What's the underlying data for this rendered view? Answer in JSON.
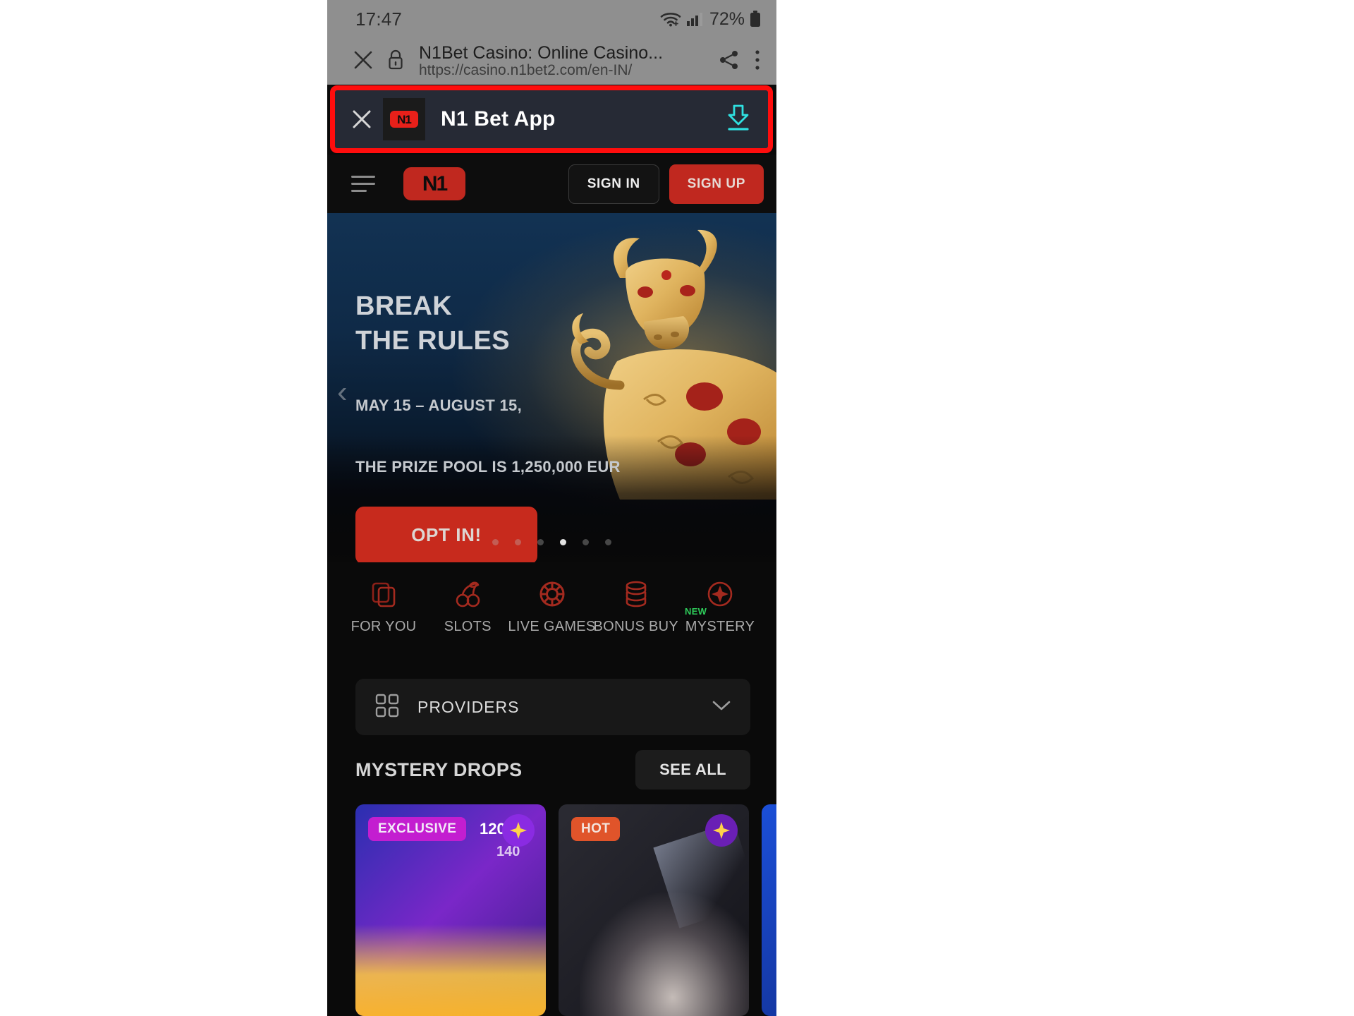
{
  "status_bar": {
    "time": "17:47",
    "battery_percent": "72%",
    "icons": [
      "wifi-icon",
      "cellular-signal-icon",
      "battery-icon"
    ]
  },
  "browser": {
    "close_icon": "close-icon",
    "lock_icon": "lock-icon",
    "page_title": "N1Bet Casino: Online Casino...",
    "page_url": "https://casino.n1bet2.com/en-IN/",
    "share_icon": "share-icon",
    "menu_icon": "overflow-menu-icon"
  },
  "app_banner": {
    "close_icon": "close-icon",
    "app_logo_text": "N1",
    "app_name": "N1 Bet App",
    "download_icon": "download-icon",
    "highlight_color": "#ff0d0d",
    "download_icon_color": "#2fe0e0",
    "background": "#262a35"
  },
  "site_header": {
    "menu_icon": "hamburger-menu-icon",
    "brand_text": "N1",
    "brand_color": "#c0281f",
    "sign_in_label": "SIGN IN",
    "sign_up_label": "SIGN UP"
  },
  "hero": {
    "heading_line1": "BREAK",
    "heading_line2": "THE RULES",
    "sub_line1": "MAY 15 – AUGUST 15,",
    "sub_line2": "THE PRIZE POOL IS 1,250,000 EUR",
    "cta_label": "OPT IN!",
    "prev_arrow_icon": "chevron-left-icon",
    "slide_count": 6,
    "active_slide": 4,
    "cta_color": "#c72a1d"
  },
  "categories": [
    {
      "label": "FOR YOU",
      "icon": "cards-stack-icon",
      "badge": ""
    },
    {
      "label": "SLOTS",
      "icon": "cherries-icon",
      "badge": ""
    },
    {
      "label": "LIVE GAMES",
      "icon": "poker-chip-icon",
      "badge": ""
    },
    {
      "label": "BONUS BUY",
      "icon": "coins-stack-icon",
      "badge": ""
    },
    {
      "label": "MYSTERY",
      "icon": "sparkle-icon",
      "badge": "NEW"
    }
  ],
  "providers": {
    "icon": "grid-squares-icon",
    "label": "PROVIDERS",
    "chevron_icon": "chevron-down-icon"
  },
  "mystery_drops": {
    "title": "MYSTERY DROPS",
    "see_all_label": "SEE ALL",
    "cards": [
      {
        "badge": "EXCLUSIVE",
        "badge_color": "#c31ed0",
        "num_primary": "120",
        "num_secondary": "140",
        "corner_icon": "sparkle-icon"
      },
      {
        "badge": "HOT",
        "badge_color": "#e0542a",
        "num_primary": "",
        "num_secondary": "",
        "corner_icon": "sparkle-icon"
      },
      {
        "badge": "",
        "badge_color": "#1b4fd8",
        "num_primary": "",
        "num_secondary": "",
        "corner_icon": ""
      }
    ]
  }
}
